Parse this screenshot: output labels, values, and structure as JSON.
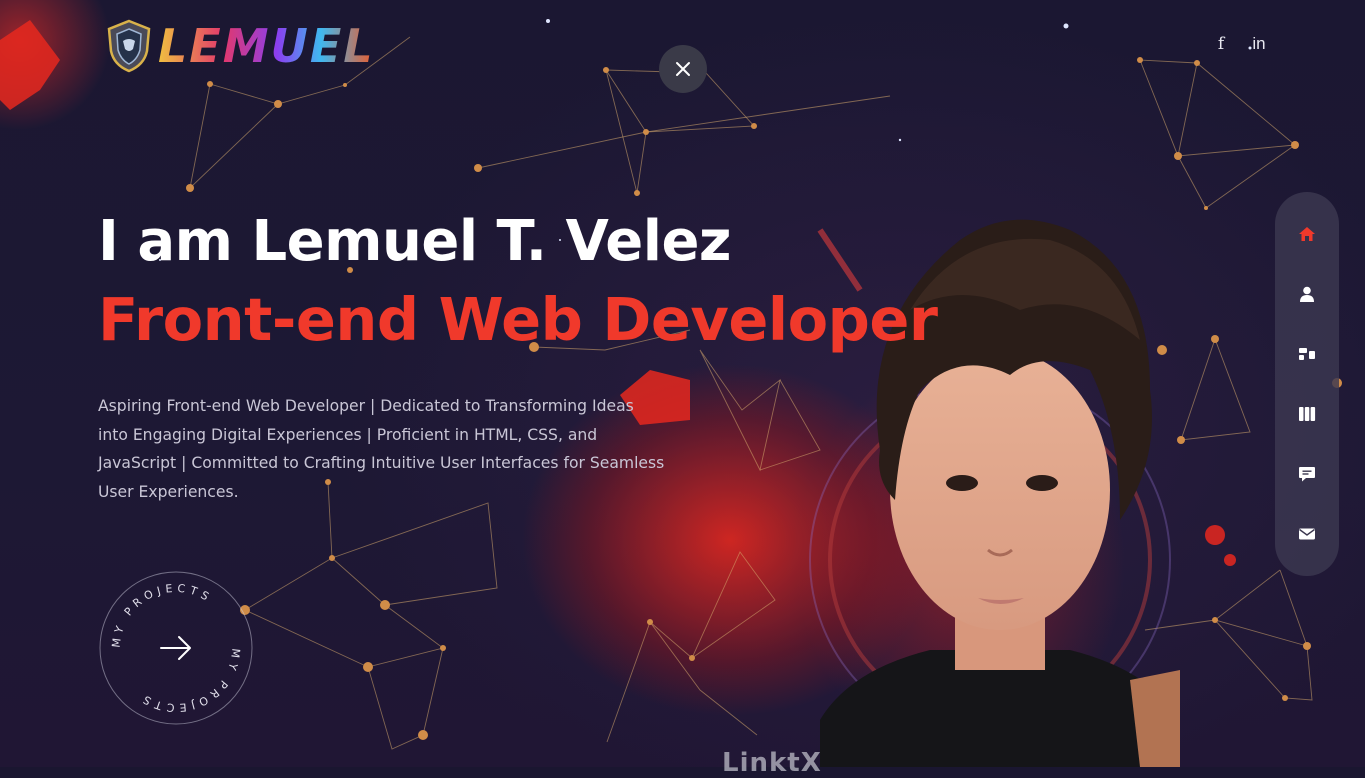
{
  "brand": {
    "logo_text": "LEMUEL",
    "icon": "shield-logo-icon"
  },
  "header": {
    "close_icon": "close-icon",
    "social": [
      {
        "label": "f",
        "icon": "facebook-icon"
      },
      {
        "label": "in",
        "icon": "linkedin-icon"
      }
    ]
  },
  "hero": {
    "title": "I am Lemuel T. Velez",
    "subtitle": "Front-end Web Developer",
    "description": "Aspiring Front-end Web Developer | Dedicated to Transforming Ideas into Engaging Digital Experiences | Proficient in HTML, CSS, and JavaScript | Committed to Crafting Intuitive User Interfaces for Seamless User Experiences."
  },
  "projects_badge": {
    "label": "MY PROJECTS",
    "icon": "arrow-right-icon"
  },
  "sidenav": {
    "items": [
      {
        "name": "home",
        "icon": "home-icon",
        "active": true
      },
      {
        "name": "about",
        "icon": "user-icon",
        "active": false
      },
      {
        "name": "services",
        "icon": "services-icon",
        "active": false
      },
      {
        "name": "portfolio",
        "icon": "columns-icon",
        "active": false
      },
      {
        "name": "testimonials",
        "icon": "chat-icon",
        "active": false
      },
      {
        "name": "contact",
        "icon": "envelope-icon",
        "active": false
      }
    ]
  },
  "shirt_text": "LinktX",
  "colors": {
    "accent": "#f0392b",
    "background": "#1b1732",
    "nav_bg": "#3c3850",
    "text_muted": "#c9c6d6"
  }
}
